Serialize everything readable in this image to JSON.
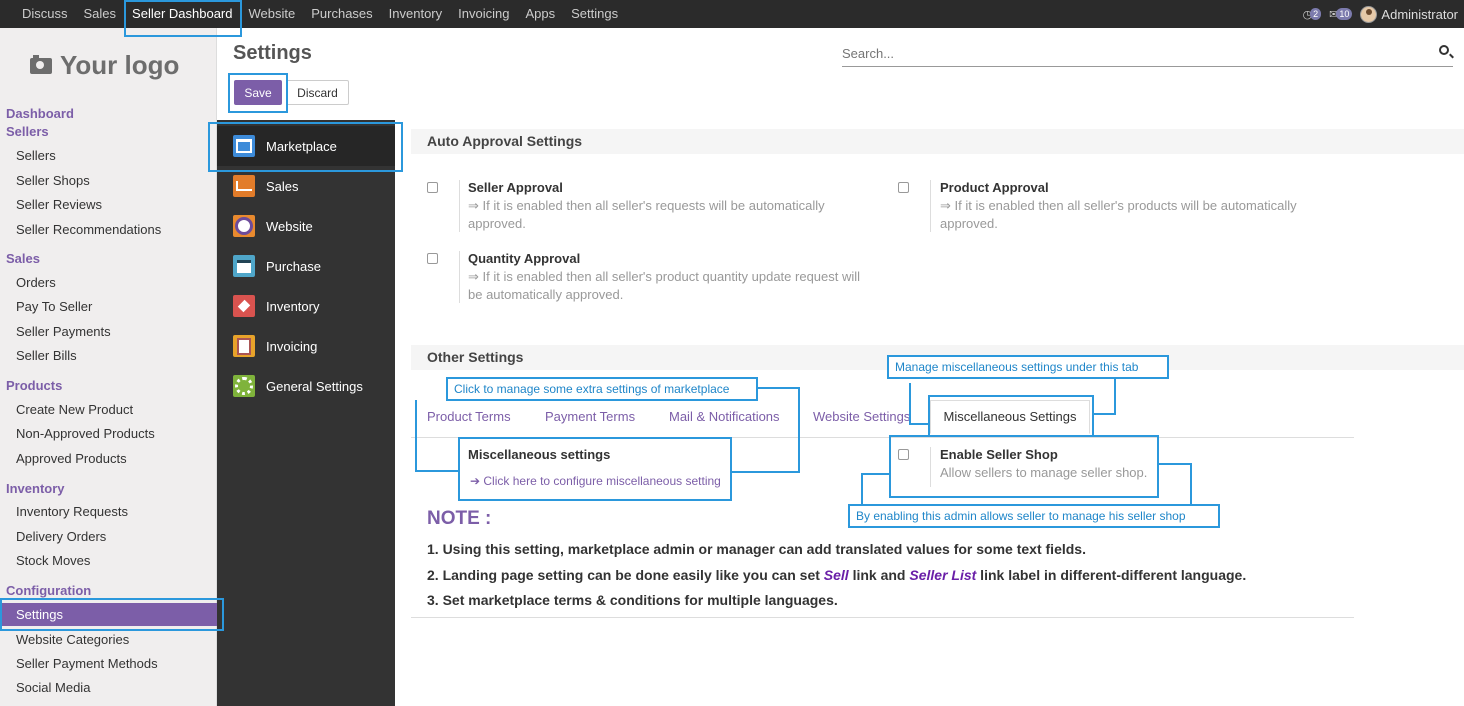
{
  "topbar": {
    "menu": [
      "Discuss",
      "Sales",
      "Seller Dashboard",
      "Website",
      "Purchases",
      "Inventory",
      "Invoicing",
      "Apps",
      "Settings"
    ],
    "active": "Seller Dashboard",
    "activity_count": "2",
    "message_count": "10",
    "user": "Administrator"
  },
  "sidebar": {
    "logo": "Your logo",
    "dashboard": "Dashboard",
    "sections": {
      "sellers": {
        "title": "Sellers",
        "items": [
          "Sellers",
          "Seller Shops",
          "Seller Reviews",
          "Seller Recommendations"
        ]
      },
      "sales": {
        "title": "Sales",
        "items": [
          "Orders",
          "Pay To Seller",
          "Seller Payments",
          "Seller Bills"
        ]
      },
      "products": {
        "title": "Products",
        "items": [
          "Create New Product",
          "Non-Approved Products",
          "Approved Products"
        ]
      },
      "inventory": {
        "title": "Inventory",
        "items": [
          "Inventory Requests",
          "Delivery Orders",
          "Stock Moves"
        ]
      },
      "configuration": {
        "title": "Configuration",
        "items": [
          "Settings",
          "Website Categories",
          "Seller Payment Methods",
          "Social Media"
        ]
      }
    }
  },
  "header": {
    "title": "Settings",
    "search_placeholder": "Search...",
    "save": "Save",
    "discard": "Discard"
  },
  "apps": [
    "Marketplace",
    "Sales",
    "Website",
    "Purchase",
    "Inventory",
    "Invoicing",
    "General Settings"
  ],
  "auto_approval": {
    "title": "Auto Approval Settings",
    "seller": {
      "title": "Seller Approval",
      "desc1": "⇒ If it is enabled then all seller's requests will be automatically",
      "desc2": "approved."
    },
    "product": {
      "title": "Product Approval",
      "desc1": "⇒ If it is enabled then all seller's products will be automatically",
      "desc2": "approved."
    },
    "quantity": {
      "title": "Quantity Approval",
      "desc1": "⇒ If it is enabled then all seller's product quantity update request will",
      "desc2": "be automatically approved."
    }
  },
  "other": {
    "title": "Other Settings",
    "tabs": [
      "Product Terms",
      "Payment Terms",
      "Mail & Notifications",
      "Website Settings",
      "Miscellaneous Settings"
    ],
    "misc_title": "Miscellaneous settings",
    "misc_link": "➔ Click here to configure miscellaneous setting",
    "shop_title": "Enable Seller Shop",
    "shop_desc": "Allow sellers to manage seller shop."
  },
  "note": {
    "title": "NOTE :",
    "line1": "1. Using this setting, marketplace admin or manager can add translated values for some text fields.",
    "line2_a": "2. Landing page setting can be done easily like you can set ",
    "line2_sell": "Sell",
    "line2_b": " link and ",
    "line2_list": "Seller List",
    "line2_c": " link label in different-different language.",
    "line3": "3. Set marketplace terms & conditions for multiple languages."
  },
  "callouts": {
    "extra": "Click to manage some extra settings of marketplace",
    "misc_tab": "Manage miscellaneous settings under this tab",
    "shop": "By enabling this admin allows seller to manage his seller shop"
  },
  "colors": {
    "accent": "#7c5ea8",
    "topbar": "#2b2b2b",
    "highlight": "#2b98dc"
  }
}
